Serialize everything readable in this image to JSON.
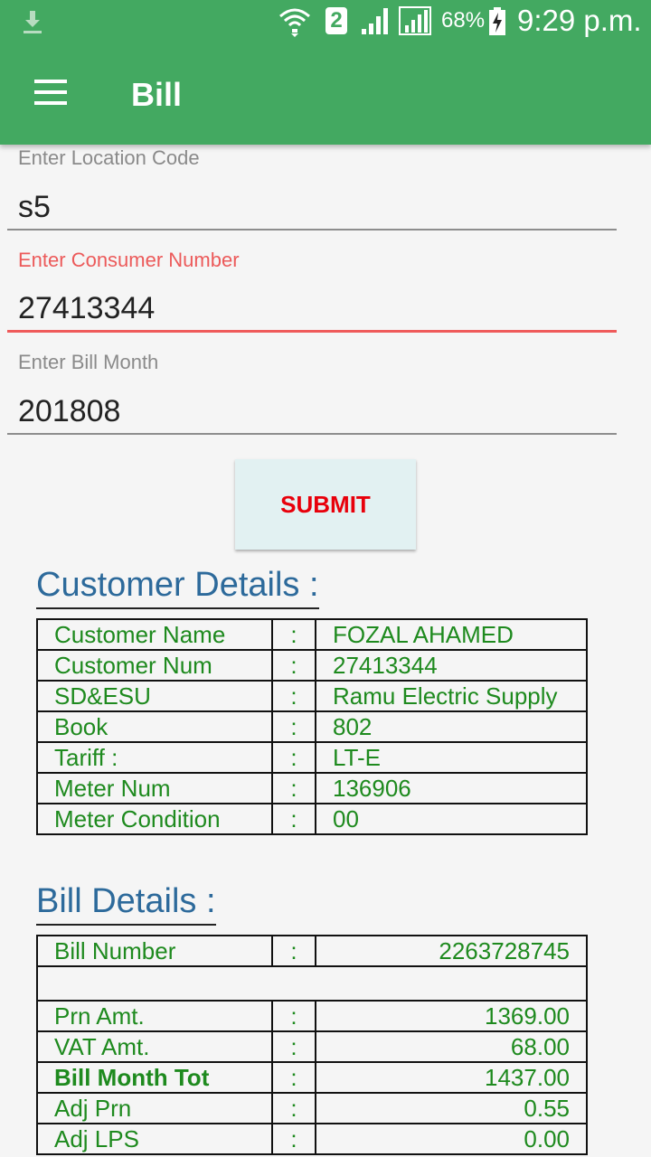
{
  "status_bar": {
    "battery": "68%",
    "sim_slot": "2",
    "time": "9:29 p.m."
  },
  "app_bar": {
    "title": "Bill"
  },
  "form": {
    "location_label": "Enter Location Code",
    "location_value": "s5",
    "consumer_label": "Enter Consumer Number",
    "consumer_value": "27413344",
    "month_label": "Enter Bill Month",
    "month_value": "201808",
    "submit_label": "SUBMIT"
  },
  "customer": {
    "heading": "Customer Details :",
    "rows": [
      {
        "label": "Customer Name",
        "sep": ":",
        "value": "FOZAL AHAMED"
      },
      {
        "label": "Customer Num",
        "sep": ":",
        "value": "27413344"
      },
      {
        "label": "SD&ESU",
        "sep": ":",
        "value": "Ramu Electric Supply"
      },
      {
        "label": "Book",
        "sep": ":",
        "value": "802"
      },
      {
        "label": "Tariff :",
        "sep": ":",
        "value": "LT-E"
      },
      {
        "label": "Meter Num",
        "sep": ":",
        "value": "136906"
      },
      {
        "label": "Meter Condition",
        "sep": ":",
        "value": "00"
      }
    ]
  },
  "bill": {
    "heading": "Bill Details :",
    "number_row": {
      "label": "Bill Number",
      "sep": ":",
      "value": "2263728745"
    },
    "rows": [
      {
        "label": "Prn Amt.",
        "sep": ":",
        "value": "1369.00"
      },
      {
        "label": "VAT Amt.",
        "sep": ":",
        "value": "68.00"
      },
      {
        "label": "Bill Month Tot",
        "sep": ":",
        "value": "1437.00"
      },
      {
        "label": "Adj Prn",
        "sep": ":",
        "value": "0.55"
      },
      {
        "label": "Adj LPS",
        "sep": ":",
        "value": "0.00"
      }
    ]
  },
  "colors": {
    "app_bar": "#43a961",
    "value_text": "#1e8a1e",
    "heading": "#2d6a9b",
    "error": "#ec5a5a",
    "submit_text": "#e8000b"
  }
}
